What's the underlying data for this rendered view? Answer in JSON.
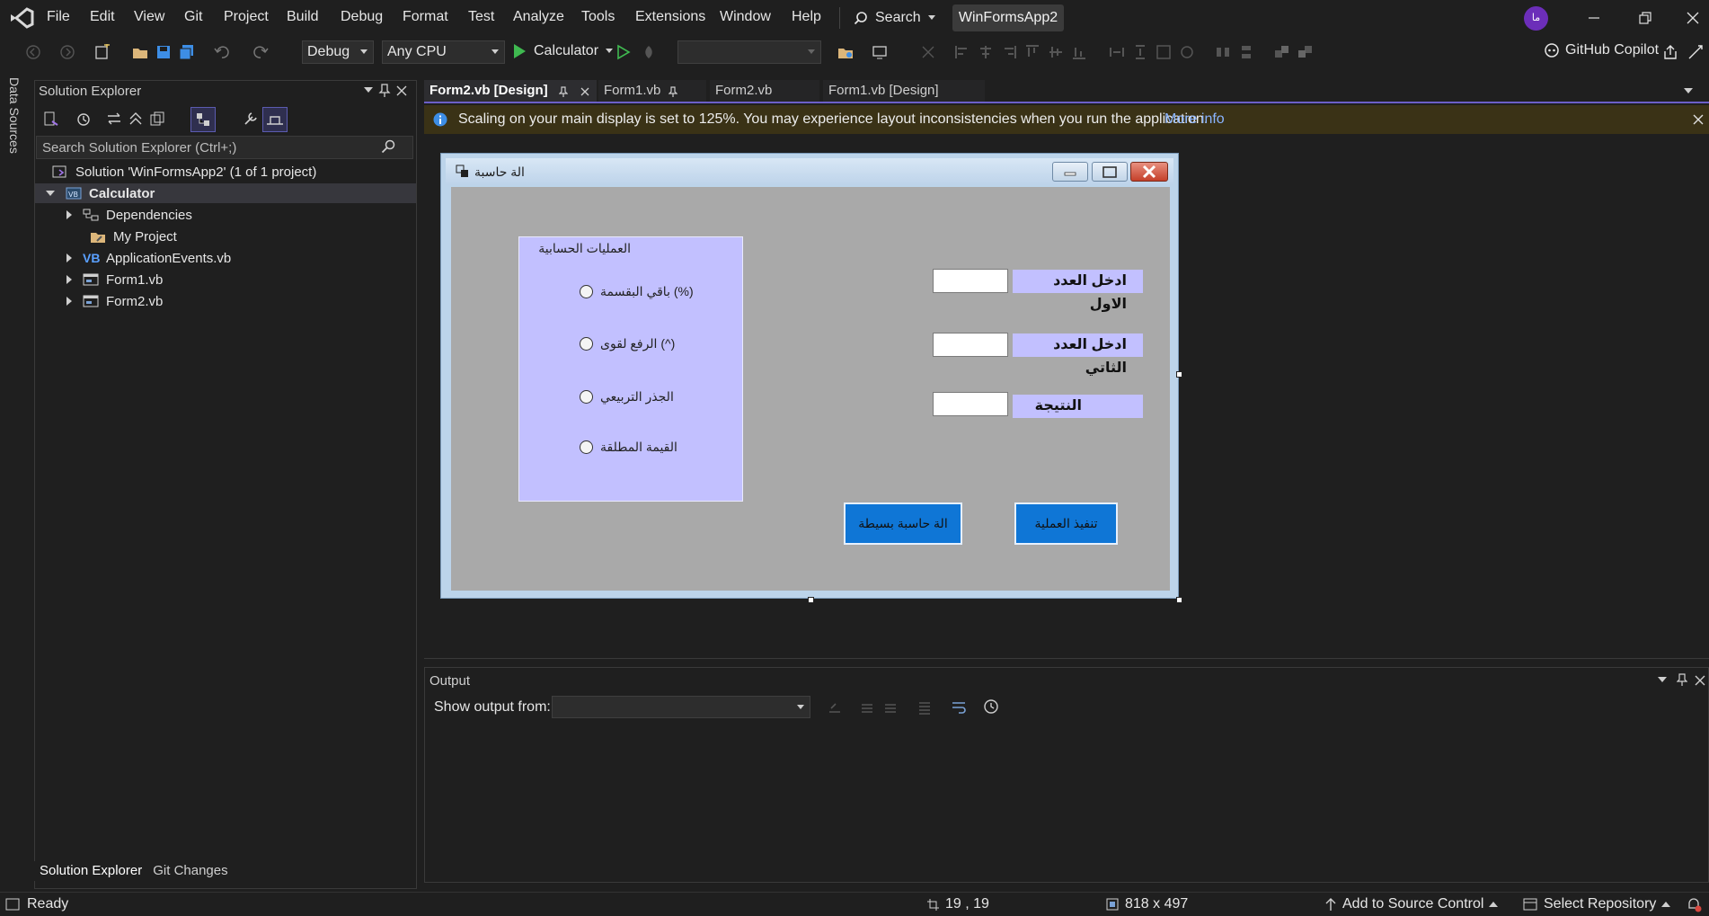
{
  "menu": {
    "items": [
      "File",
      "Edit",
      "View",
      "Git",
      "Project",
      "Build",
      "Debug",
      "Format",
      "Test",
      "Analyze",
      "Tools",
      "Extensions",
      "Window",
      "Help"
    ],
    "search_label": "Search",
    "solution_name": "WinFormsApp2",
    "avatar_initials": "ما"
  },
  "toolbar": {
    "config": "Debug",
    "platform": "Any CPU",
    "run_target": "Calculator",
    "copilot": "GitHub Copilot"
  },
  "side_strip": {
    "data_sources": "Data Sources"
  },
  "solution_explorer": {
    "title": "Solution Explorer",
    "search_placeholder": "Search Solution Explorer (Ctrl+;)",
    "solution_label": "Solution 'WinFormsApp2' (1 of 1 project)",
    "project": "Calculator",
    "nodes": [
      "Dependencies",
      "My Project",
      "ApplicationEvents.vb",
      "Form1.vb",
      "Form2.vb"
    ],
    "bottom_tabs": [
      "Solution Explorer",
      "Git Changes"
    ]
  },
  "doc_tabs": [
    "Form2.vb [Design]",
    "Form1.vb",
    "Form2.vb",
    "Form1.vb [Design]"
  ],
  "infobar": {
    "message": "Scaling on your main display is set to 125%. You may experience layout inconsistencies when you run the application.",
    "link": "More info"
  },
  "form": {
    "title": "الة حاسبة",
    "group_title": "العمليات الحسابية",
    "radios": [
      "باقي البقسمة (%)",
      "الرفع لقوى (^)",
      "الجذر التربيعي",
      "القيمة المطلقة"
    ],
    "labels": [
      "ادخل العدد الاول",
      "ادخل العدد الثاتي",
      "النتيجة"
    ],
    "execute_button": "تنفيذ العملية",
    "simple_calc_button": "الة حاسبة بسيطة"
  },
  "output": {
    "title": "Output",
    "show_from": "Show output from:"
  },
  "status": {
    "ready": "Ready",
    "position": "19 , 19",
    "size": "818 x 497",
    "source_control": "Add to Source Control",
    "repository": "Select Repository"
  },
  "colors": {
    "accent": "#6c5fc7",
    "form_client": "#a9a9a9",
    "group_fill": "#c2c0ff",
    "button_fill": "#0f76d6",
    "infobar": "#3a3216"
  }
}
